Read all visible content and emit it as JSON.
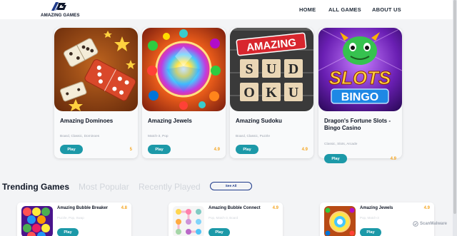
{
  "brand": {
    "name": "AMAZING GAMES"
  },
  "nav": {
    "home": "HOME",
    "all_games": "ALL GAMES",
    "about": "ABOUT US"
  },
  "featured": [
    {
      "title": "Amazing Dominoes",
      "tags": "Board, Classic, Dominoes",
      "play": "Play",
      "rating": "5"
    },
    {
      "title": "Amazing Jewels",
      "tags": "Match-3, Pop",
      "play": "Play",
      "rating": "4.9"
    },
    {
      "title": "Amazing Sudoku",
      "tags": "Board, Classic, Puzzle",
      "play": "Play",
      "rating": "4.9",
      "thumb_text": [
        "AMAZING",
        "S",
        "U",
        "D",
        "O",
        "K",
        "U"
      ]
    },
    {
      "title": "Dragon's Fortune Slots - Bingo Casino",
      "tags": "Classic, Slots, Arcade",
      "play": "Play",
      "rating": "4.9",
      "thumb_text": [
        "SLOTS",
        "BINGO"
      ]
    }
  ],
  "tabs": {
    "trending": "Trending Games",
    "popular": "Most Popular",
    "recent": "Recently Played",
    "see_all": "See All"
  },
  "trending": [
    {
      "title": "Amazing Bubble Breaker",
      "tags": "Puzzle, Pop, Swap",
      "play": "Play",
      "rating": "4.8"
    },
    {
      "title": "Amazing Bubble Connect",
      "tags": "Pop, Match-3, Board",
      "play": "Play",
      "rating": "4.9"
    },
    {
      "title": "Amazing Jewels",
      "tags": "Pop, Match-3",
      "play": "Play",
      "rating": "4.9"
    }
  ],
  "watermark": "ScanMalware",
  "colors": {
    "accent": "#1c99a8",
    "rating": "#f5a623",
    "see_all_border": "#1e3a8a"
  },
  "icons": {
    "logo": "ag-logo-icon",
    "watermark": "scanmalware-icon"
  }
}
